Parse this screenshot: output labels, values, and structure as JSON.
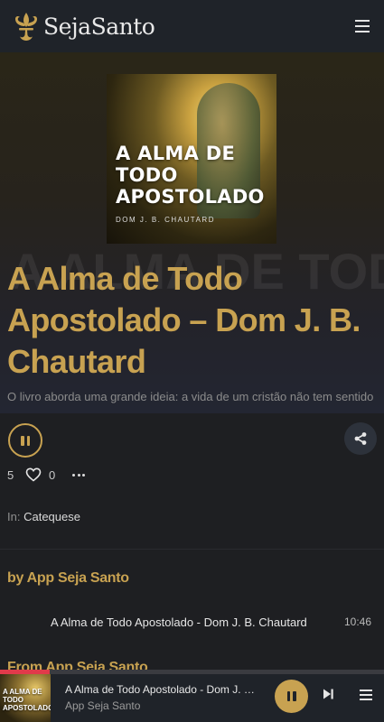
{
  "header": {
    "logo_text": "SejaSanto",
    "logo_icon": "fleur-de-lis-icon",
    "menu_icon": "hamburger-menu-icon"
  },
  "hero": {
    "cover_title": "A ALMA DE TODO APOSTOLADO",
    "cover_author": "DOM J. B. CHAUTARD",
    "background_text": "A ALMA DE TODO"
  },
  "post": {
    "title": "A Alma de Todo Apostolado – Dom J. B. Chautard",
    "description": "O livro aborda uma grande ideia: a vida de um cristão não tem sentido",
    "likes": "5",
    "dislikes": "0",
    "category_prefix": "In:",
    "category": "Catequese"
  },
  "sections": {
    "by_heading": "by App Seja Santo",
    "from_heading": "From App Seja Santo"
  },
  "episodes": [
    {
      "title": "A Alma de Todo Apostolado - Dom J. B. Chautard",
      "duration": "10:46"
    }
  ],
  "player": {
    "thumb_text": "A ALMA DE TODO APOSTOLADO",
    "title": "A Alma de Todo Apostolado - Dom J. B. Chautard",
    "subtitle": "App Seja Santo",
    "progress_fraction": 0.13,
    "state": "playing"
  },
  "colors": {
    "accent_gold": "#c8a251",
    "progress_red": "#e03a4a",
    "bar_bg": "#1f2329",
    "page_bg": "#1e1f22"
  }
}
